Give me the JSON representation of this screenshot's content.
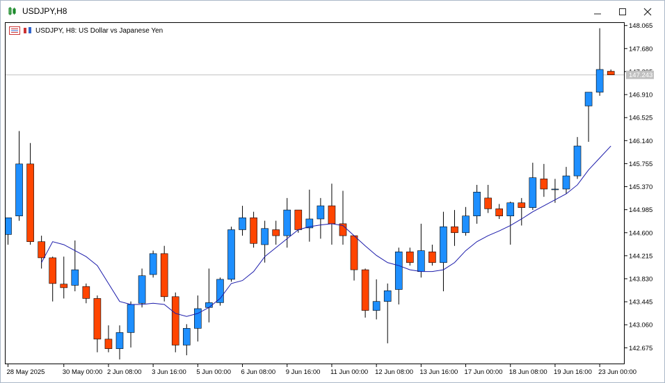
{
  "window": {
    "title": "USDJPY,H8",
    "chart_label": "USDJPY, H8:  US Dollar vs Japanese Yen",
    "current_price_label": "147.243"
  },
  "icons": [
    "chart-window-icon",
    "minimize-icon",
    "maximize-icon",
    "close-icon",
    "chart-list-icon",
    "chart-properties-icon"
  ],
  "colors": {
    "bull": "#1e8fff",
    "bear": "#ff4500",
    "ma_line": "#1a1aaa",
    "price_line": "#c0c0c0"
  },
  "chart_data": {
    "type": "candlestick",
    "symbol": "USDJPY",
    "timeframe": "H8",
    "ylim": [
      142.4,
      148.12
    ],
    "yticks": [
      "148.065",
      "147.680",
      "147.295",
      "146.910",
      "146.525",
      "146.140",
      "145.755",
      "145.370",
      "144.985",
      "144.600",
      "144.215",
      "143.830",
      "143.445",
      "143.060",
      "142.675"
    ],
    "xticks": [
      {
        "label": "28 May 2025",
        "index": 0
      },
      {
        "label": "30 May 00:00",
        "index": 5
      },
      {
        "label": "2 Jun 08:00",
        "index": 9
      },
      {
        "label": "3 Jun 16:00",
        "index": 13
      },
      {
        "label": "5 Jun 00:00",
        "index": 17
      },
      {
        "label": "6 Jun 08:00",
        "index": 21
      },
      {
        "label": "9 Jun 16:00",
        "index": 25
      },
      {
        "label": "11 Jun 00:00",
        "index": 29
      },
      {
        "label": "12 Jun 08:00",
        "index": 33
      },
      {
        "label": "13 Jun 16:00",
        "index": 37
      },
      {
        "label": "17 Jun 00:00",
        "index": 41
      },
      {
        "label": "18 Jun 08:00",
        "index": 45
      },
      {
        "label": "19 Jun 16:00",
        "index": 49
      },
      {
        "label": "23 Jun 00:00",
        "index": 53
      }
    ],
    "candles": [
      {
        "o": 144.57,
        "h": 144.85,
        "l": 144.4,
        "c": 144.85
      },
      {
        "o": 144.88,
        "h": 146.3,
        "l": 144.8,
        "c": 145.75
      },
      {
        "o": 145.75,
        "h": 146.1,
        "l": 144.4,
        "c": 144.45
      },
      {
        "o": 144.45,
        "h": 144.55,
        "l": 144.0,
        "c": 144.18
      },
      {
        "o": 144.18,
        "h": 144.2,
        "l": 143.45,
        "c": 143.75
      },
      {
        "o": 143.74,
        "h": 144.2,
        "l": 143.5,
        "c": 143.68
      },
      {
        "o": 143.72,
        "h": 144.47,
        "l": 143.62,
        "c": 143.98
      },
      {
        "o": 143.7,
        "h": 143.75,
        "l": 143.42,
        "c": 143.5
      },
      {
        "o": 143.5,
        "h": 143.55,
        "l": 142.6,
        "c": 142.82
      },
      {
        "o": 142.82,
        "h": 143.05,
        "l": 142.6,
        "c": 142.66
      },
      {
        "o": 142.66,
        "h": 143.05,
        "l": 142.48,
        "c": 142.93
      },
      {
        "o": 142.93,
        "h": 143.45,
        "l": 142.68,
        "c": 143.4
      },
      {
        "o": 143.42,
        "h": 144.0,
        "l": 143.35,
        "c": 143.88
      },
      {
        "o": 143.9,
        "h": 144.3,
        "l": 143.85,
        "c": 144.25
      },
      {
        "o": 144.25,
        "h": 144.38,
        "l": 143.45,
        "c": 143.53
      },
      {
        "o": 143.53,
        "h": 143.6,
        "l": 142.6,
        "c": 142.72
      },
      {
        "o": 142.72,
        "h": 143.07,
        "l": 142.55,
        "c": 143.0
      },
      {
        "o": 143.0,
        "h": 143.55,
        "l": 142.78,
        "c": 143.33
      },
      {
        "o": 143.35,
        "h": 144.0,
        "l": 143.1,
        "c": 143.43
      },
      {
        "o": 143.43,
        "h": 143.85,
        "l": 143.38,
        "c": 143.82
      },
      {
        "o": 143.82,
        "h": 144.7,
        "l": 143.78,
        "c": 144.65
      },
      {
        "o": 144.65,
        "h": 145.05,
        "l": 144.55,
        "c": 144.85
      },
      {
        "o": 144.85,
        "h": 144.95,
        "l": 144.35,
        "c": 144.42
      },
      {
        "o": 144.4,
        "h": 144.8,
        "l": 144.1,
        "c": 144.67
      },
      {
        "o": 144.65,
        "h": 144.8,
        "l": 144.4,
        "c": 144.55
      },
      {
        "o": 144.55,
        "h": 145.18,
        "l": 144.35,
        "c": 144.98
      },
      {
        "o": 144.98,
        "h": 144.98,
        "l": 144.6,
        "c": 144.65
      },
      {
        "o": 144.68,
        "h": 145.32,
        "l": 144.45,
        "c": 144.83
      },
      {
        "o": 144.83,
        "h": 145.18,
        "l": 144.5,
        "c": 145.05
      },
      {
        "o": 145.05,
        "h": 145.42,
        "l": 144.4,
        "c": 144.75
      },
      {
        "o": 144.75,
        "h": 145.3,
        "l": 144.4,
        "c": 144.55
      },
      {
        "o": 144.55,
        "h": 144.55,
        "l": 143.8,
        "c": 143.98
      },
      {
        "o": 143.98,
        "h": 144.0,
        "l": 143.18,
        "c": 143.3
      },
      {
        "o": 143.3,
        "h": 143.82,
        "l": 143.15,
        "c": 143.45
      },
      {
        "o": 143.45,
        "h": 143.75,
        "l": 142.75,
        "c": 143.63
      },
      {
        "o": 143.65,
        "h": 144.35,
        "l": 143.4,
        "c": 144.28
      },
      {
        "o": 144.28,
        "h": 144.35,
        "l": 144.05,
        "c": 144.1
      },
      {
        "o": 143.95,
        "h": 144.75,
        "l": 143.85,
        "c": 144.3
      },
      {
        "o": 144.28,
        "h": 144.4,
        "l": 144.05,
        "c": 144.1
      },
      {
        "o": 144.1,
        "h": 144.95,
        "l": 143.62,
        "c": 144.7
      },
      {
        "o": 144.7,
        "h": 144.98,
        "l": 144.38,
        "c": 144.6
      },
      {
        "o": 144.6,
        "h": 145.03,
        "l": 144.55,
        "c": 144.88
      },
      {
        "o": 144.88,
        "h": 145.4,
        "l": 144.75,
        "c": 145.28
      },
      {
        "o": 145.18,
        "h": 145.4,
        "l": 144.93,
        "c": 145.0
      },
      {
        "o": 145.0,
        "h": 145.08,
        "l": 144.83,
        "c": 144.88
      },
      {
        "o": 144.88,
        "h": 145.12,
        "l": 144.4,
        "c": 145.1
      },
      {
        "o": 145.1,
        "h": 145.18,
        "l": 144.72,
        "c": 145.02
      },
      {
        "o": 145.02,
        "h": 145.77,
        "l": 144.98,
        "c": 145.52
      },
      {
        "o": 145.5,
        "h": 145.75,
        "l": 145.2,
        "c": 145.33
      },
      {
        "o": 145.33,
        "h": 145.5,
        "l": 145.1,
        "c": 145.33
      },
      {
        "o": 145.33,
        "h": 145.7,
        "l": 145.25,
        "c": 145.55
      },
      {
        "o": 145.55,
        "h": 146.2,
        "l": 145.5,
        "c": 146.05
      },
      {
        "o": 146.72,
        "h": 146.95,
        "l": 146.12,
        "c": 146.95
      },
      {
        "o": 146.95,
        "h": 148.02,
        "l": 146.89,
        "c": 147.33
      },
      {
        "o": 147.3,
        "h": 147.33,
        "l": 147.24,
        "c": 147.24
      }
    ],
    "moving_average": [
      null,
      null,
      null,
      144.1,
      144.45,
      144.4,
      144.3,
      144.2,
      144.05,
      143.75,
      143.45,
      143.4,
      143.4,
      143.42,
      143.4,
      143.25,
      143.2,
      143.25,
      143.35,
      143.5,
      143.75,
      143.8,
      143.95,
      144.2,
      144.35,
      144.5,
      144.65,
      144.7,
      144.73,
      144.75,
      144.72,
      144.55,
      144.38,
      144.22,
      144.1,
      144.05,
      143.98,
      143.95,
      143.95,
      143.98,
      144.1,
      144.3,
      144.45,
      144.55,
      144.63,
      144.72,
      144.83,
      144.95,
      145.05,
      145.15,
      145.25,
      145.4,
      145.65,
      145.85,
      146.05
    ]
  }
}
